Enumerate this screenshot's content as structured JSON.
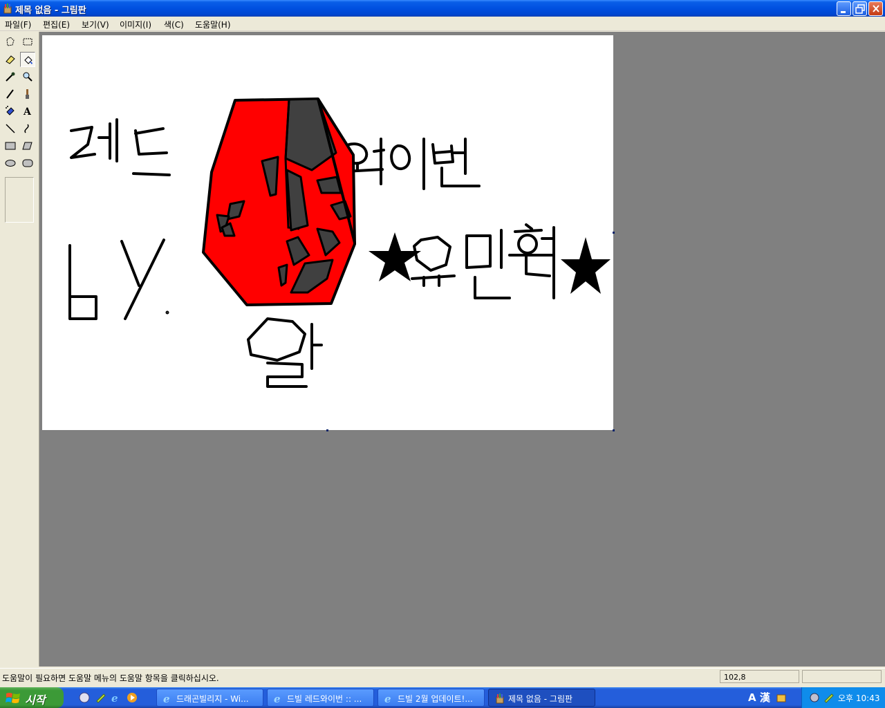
{
  "window": {
    "title": "제목 없음 - 그림판"
  },
  "menu": {
    "items": [
      "파일(F)",
      "편집(E)",
      "보기(V)",
      "이미지(I)",
      "색(C)",
      "도움말(H)"
    ]
  },
  "toolbox": {
    "tools": [
      "free-select",
      "rect-select",
      "eraser",
      "fill",
      "color-picker",
      "magnifier",
      "pencil",
      "brush",
      "airbrush",
      "text",
      "line",
      "curve",
      "rectangle",
      "polygon",
      "ellipse",
      "rounded-rectangle"
    ],
    "active_tool": "fill"
  },
  "canvas": {
    "drawing_texts": [
      "레드",
      "와이번",
      "by.",
      "★유민혁★",
      "알"
    ],
    "colors": {
      "egg": "#FF0000",
      "shell_patch": "#404040",
      "ink": "#000000"
    }
  },
  "status": {
    "help_text": "도움말이 필요하면 도움말 메뉴의 도움말 항목을 클릭하십시오.",
    "coords": "102,8"
  },
  "taskbar": {
    "start_label": "시작",
    "tasks": [
      {
        "label": "드래곤빌리지 - Wi...",
        "icon": "ie-icon",
        "active": false
      },
      {
        "label": "드빌 레드와이번 :: ...",
        "icon": "ie-icon",
        "active": false
      },
      {
        "label": "드빌 2월 업데이트!...",
        "icon": "ie-icon",
        "active": false
      },
      {
        "label": "제목 없음 - 그림판",
        "icon": "paint-icon",
        "active": true
      }
    ],
    "lang_indicator": "A 漢",
    "clock": "오후 10:43"
  }
}
